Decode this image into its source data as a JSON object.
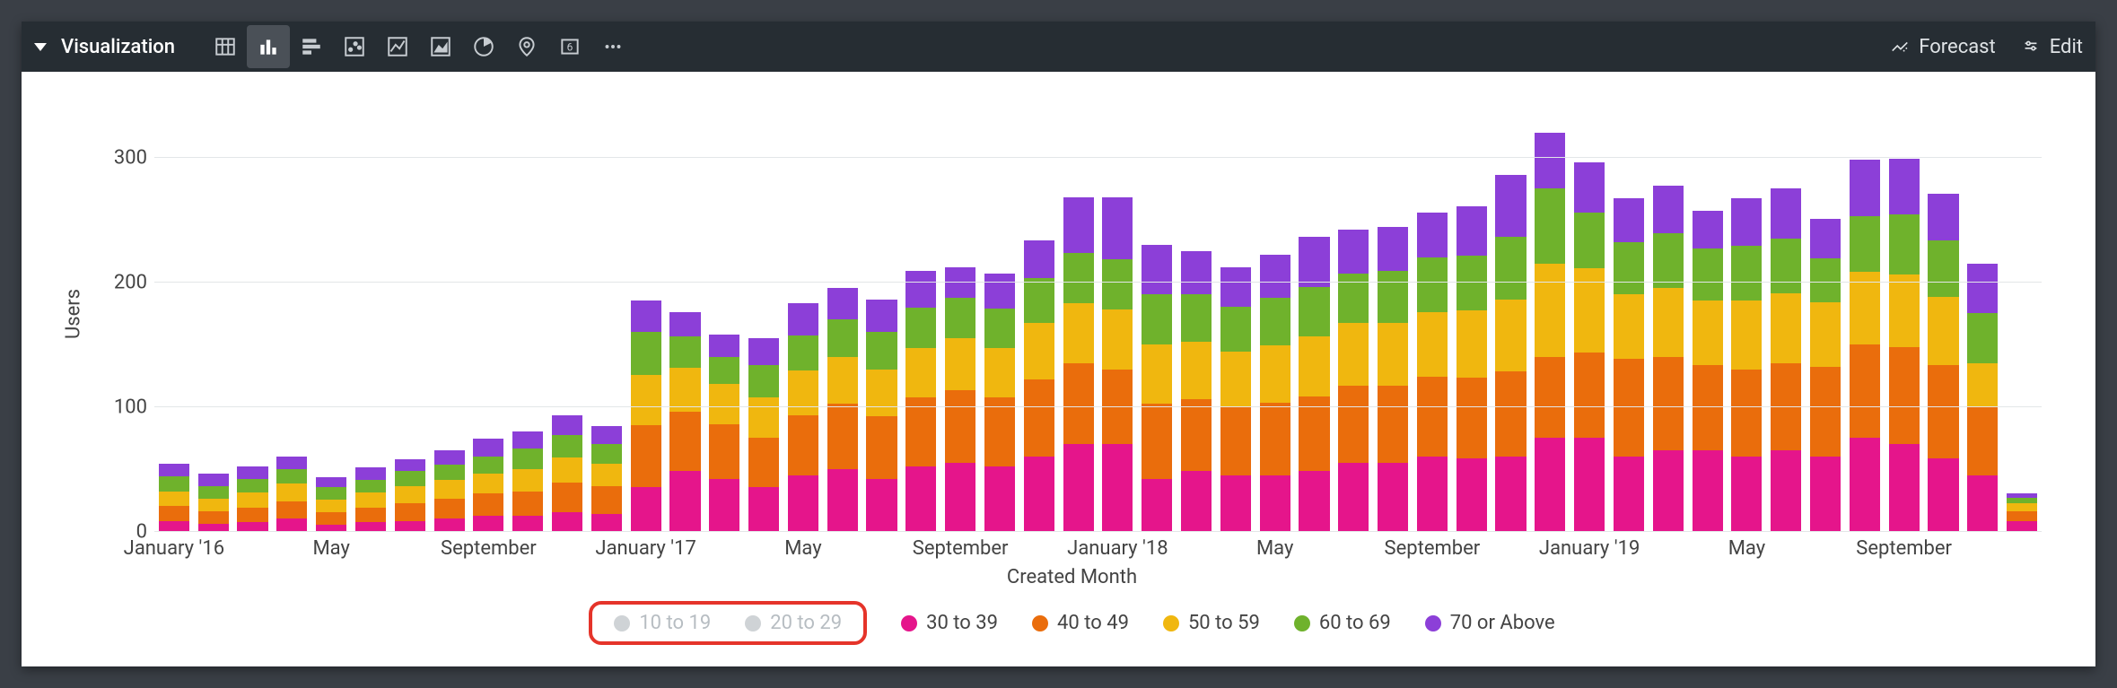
{
  "toolbar": {
    "title": "Visualization",
    "forecast": "Forecast",
    "edit": "Edit"
  },
  "chart_data": {
    "type": "bar",
    "stacked": true,
    "xlabel": "Created Month",
    "ylabel": "Users",
    "ylim": [
      0,
      350
    ],
    "yticks": [
      0,
      100,
      200,
      300
    ],
    "categories": [
      "January '16",
      "February '16",
      "March '16",
      "April '16",
      "May '16",
      "June '16",
      "July '16",
      "August '16",
      "September '16",
      "October '16",
      "November '16",
      "December '16",
      "January '17",
      "February '17",
      "March '17",
      "April '17",
      "May '17",
      "June '17",
      "July '17",
      "August '17",
      "September '17",
      "October '17",
      "November '17",
      "December '17",
      "January '18",
      "February '18",
      "March '18",
      "April '18",
      "May '18",
      "June '18",
      "July '18",
      "August '18",
      "September '18",
      "October '18",
      "November '18",
      "December '18",
      "January '19",
      "February '19",
      "March '19",
      "April '19",
      "May '19",
      "June '19",
      "July '19",
      "August '19",
      "September '19",
      "October '19",
      "November '19",
      "December '19"
    ],
    "x_tick_indices": [
      0,
      4,
      8,
      12,
      16,
      20,
      24,
      28,
      32,
      36,
      40,
      44
    ],
    "x_tick_labels": [
      "January '16",
      "May",
      "September",
      "January '17",
      "May",
      "September",
      "January '18",
      "May",
      "September",
      "January '19",
      "May",
      "September"
    ],
    "series": [
      {
        "name": "30 to 39",
        "color": "#e5158b",
        "visible": true,
        "values": [
          8,
          6,
          7,
          10,
          5,
          7,
          8,
          10,
          12,
          12,
          15,
          14,
          35,
          48,
          42,
          35,
          45,
          50,
          42,
          52,
          55,
          52,
          60,
          70,
          70,
          42,
          48,
          45,
          45,
          48,
          55,
          55,
          60,
          58,
          60,
          75,
          75,
          60,
          65,
          65,
          60,
          65,
          60,
          75,
          70,
          58,
          45,
          8
        ]
      },
      {
        "name": "40 to 49",
        "color": "#ea6d0c",
        "visible": true,
        "values": [
          12,
          10,
          12,
          14,
          10,
          12,
          14,
          16,
          18,
          20,
          24,
          22,
          50,
          48,
          44,
          40,
          48,
          52,
          50,
          55,
          58,
          55,
          62,
          65,
          60,
          60,
          58,
          55,
          58,
          60,
          62,
          62,
          64,
          65,
          68,
          65,
          68,
          78,
          75,
          68,
          70,
          70,
          72,
          75,
          78,
          75,
          55,
          8
        ]
      },
      {
        "name": "50 to 59",
        "color": "#f0b70f",
        "visible": true,
        "values": [
          12,
          10,
          12,
          14,
          10,
          12,
          14,
          15,
          16,
          18,
          20,
          18,
          40,
          35,
          32,
          32,
          36,
          38,
          38,
          40,
          42,
          40,
          45,
          48,
          48,
          48,
          46,
          44,
          46,
          48,
          50,
          50,
          52,
          54,
          58,
          75,
          68,
          52,
          55,
          52,
          55,
          56,
          52,
          58,
          58,
          55,
          35,
          6
        ]
      },
      {
        "name": "60 to 69",
        "color": "#6fb22c",
        "visible": true,
        "values": [
          12,
          10,
          11,
          12,
          10,
          10,
          12,
          12,
          14,
          16,
          18,
          16,
          35,
          25,
          22,
          26,
          28,
          30,
          30,
          32,
          32,
          32,
          36,
          40,
          40,
          40,
          38,
          36,
          38,
          40,
          40,
          42,
          44,
          44,
          50,
          60,
          45,
          42,
          44,
          42,
          44,
          44,
          35,
          45,
          48,
          45,
          40,
          5
        ]
      },
      {
        "name": "70 or Above",
        "color": "#8c3fd8",
        "visible": true,
        "values": [
          10,
          10,
          10,
          10,
          8,
          10,
          10,
          12,
          14,
          14,
          16,
          14,
          25,
          20,
          18,
          22,
          26,
          25,
          26,
          30,
          25,
          28,
          30,
          45,
          50,
          40,
          35,
          32,
          35,
          40,
          35,
          35,
          36,
          40,
          50,
          45,
          40,
          35,
          38,
          30,
          38,
          40,
          32,
          45,
          45,
          38,
          40,
          3
        ]
      },
      {
        "name": "10 to 19",
        "color": "#cfd3d6",
        "visible": false,
        "values": []
      },
      {
        "name": "20 to 29",
        "color": "#cfd3d6",
        "visible": false,
        "values": []
      }
    ],
    "legend_order": [
      "10 to 19",
      "20 to 29",
      "30 to 39",
      "40 to 49",
      "50 to 59",
      "60 to 69",
      "70 or Above"
    ],
    "disabled_highlight": [
      "10 to 19",
      "20 to 29"
    ]
  }
}
